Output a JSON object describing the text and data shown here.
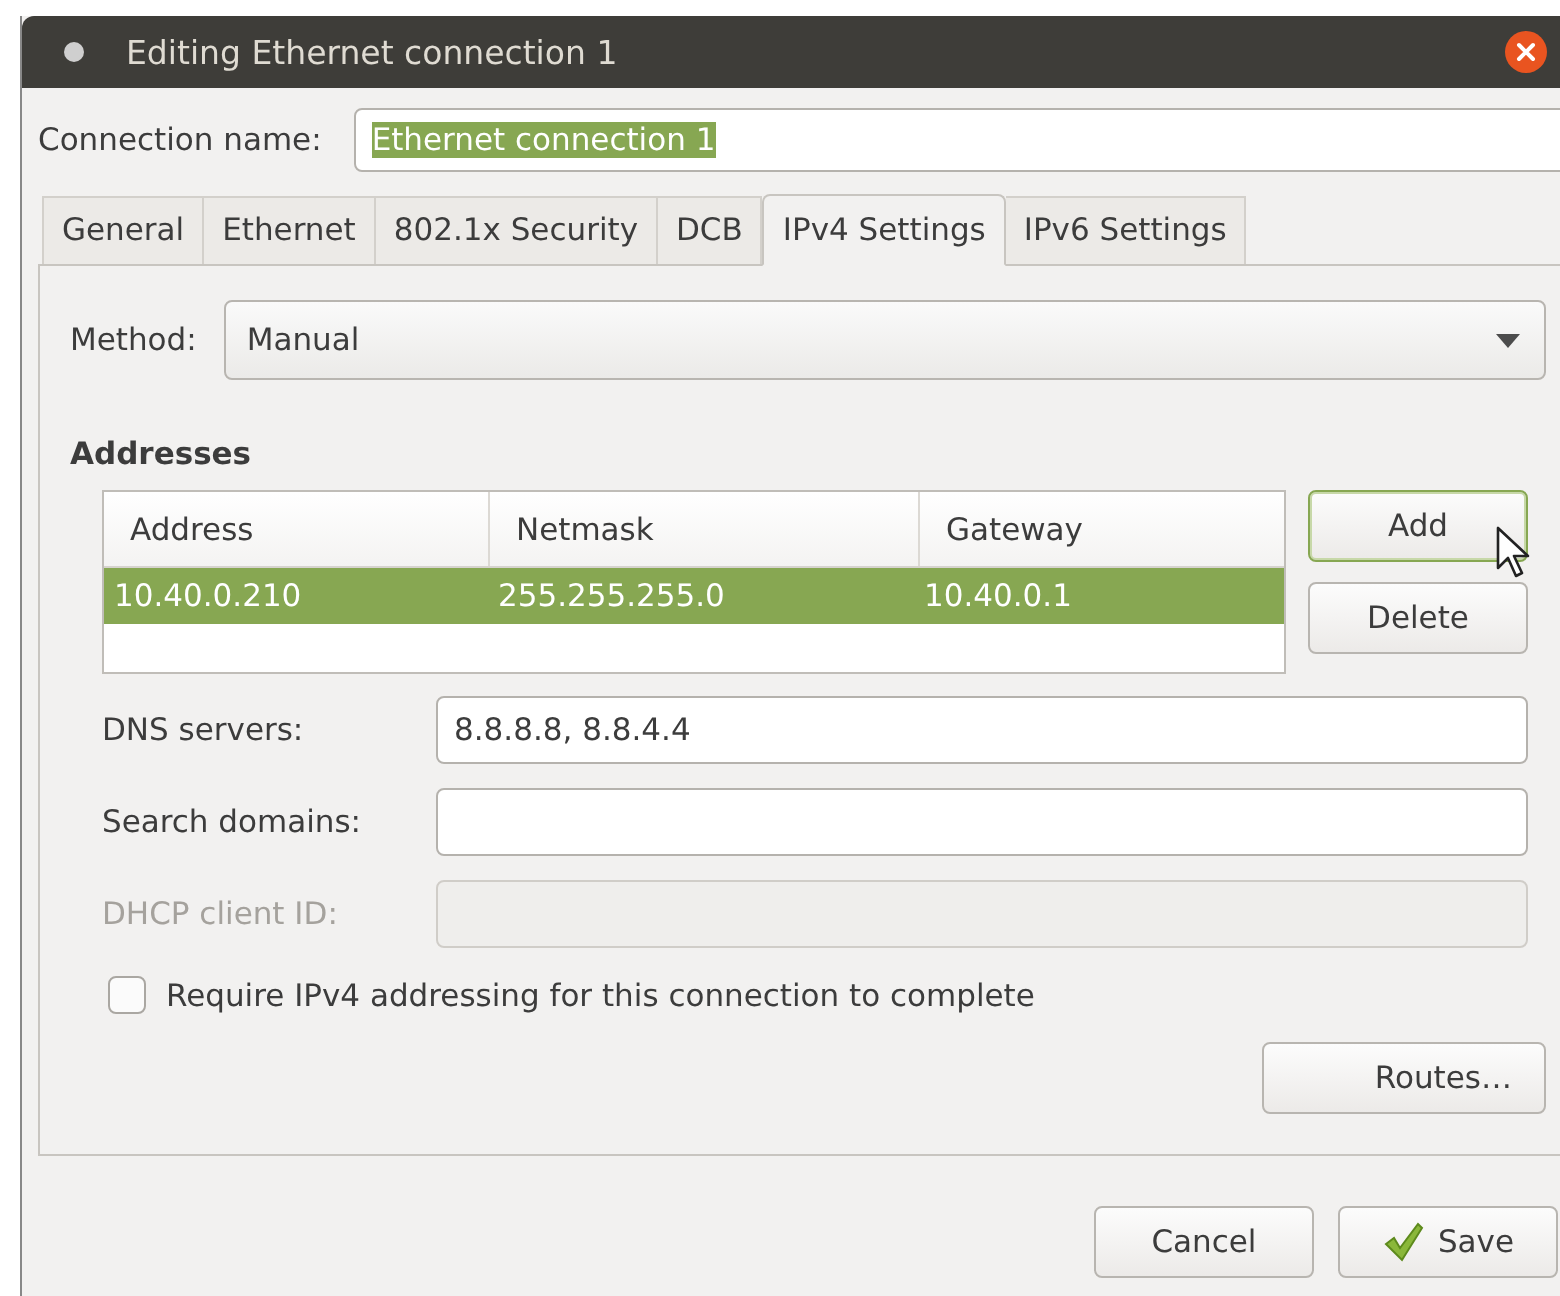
{
  "window": {
    "title": "Editing Ethernet connection 1"
  },
  "connection_name": {
    "label": "Connection name:",
    "value": "Ethernet connection 1",
    "text_selected": true
  },
  "tabs": [
    {
      "label": "General",
      "selected": false
    },
    {
      "label": "Ethernet",
      "selected": false
    },
    {
      "label": "802.1x Security",
      "selected": false
    },
    {
      "label": "DCB",
      "selected": false
    },
    {
      "label": "IPv4 Settings",
      "selected": true
    },
    {
      "label": "IPv6 Settings",
      "selected": false
    }
  ],
  "method": {
    "label": "Method:",
    "value": "Manual"
  },
  "addresses": {
    "heading": "Addresses",
    "columns": [
      "Address",
      "Netmask",
      "Gateway"
    ],
    "rows": [
      {
        "cells": [
          "10.40.0.210",
          "255.255.255.0",
          "10.40.0.1"
        ],
        "selected": true
      }
    ],
    "buttons": [
      {
        "label": "Add",
        "focused": true
      },
      {
        "label": "Delete",
        "focused": false
      }
    ]
  },
  "fields": [
    {
      "label": "DNS servers:",
      "value": "8.8.8.8, 8.8.4.4",
      "disabled": false
    },
    {
      "label": "Search domains:",
      "disabled": false
    },
    {
      "label": "DHCP client ID:",
      "disabled": true
    }
  ],
  "require_checkbox": {
    "label": "Require IPv4 addressing for this connection to complete",
    "checked": false
  },
  "routes_button": "Routes…",
  "dialog_buttons": [
    {
      "label": "Cancel",
      "kind": "plain"
    },
    {
      "label": "Save",
      "kind": "confirm"
    }
  ]
}
